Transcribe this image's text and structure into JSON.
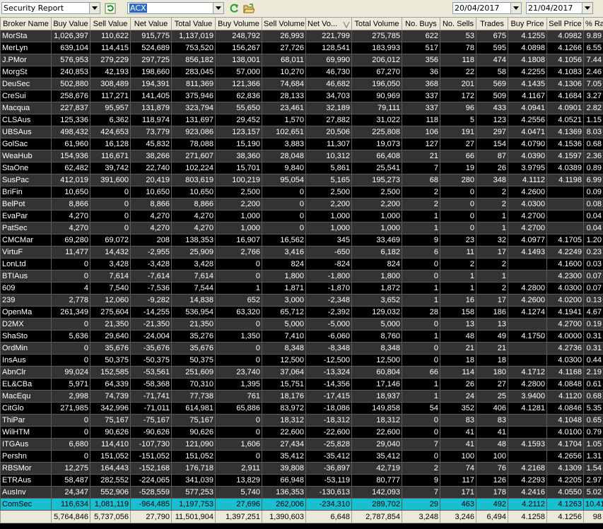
{
  "toolbar": {
    "report_select": "Security Report",
    "security_code": "ACX",
    "date_from": "20/04/2017",
    "date_to": "21/04/2017"
  },
  "table": {
    "columns": [
      "Broker Name",
      "Buy Value",
      "Sell Value",
      "Net Value",
      "Total Value",
      "Buy Volume",
      "Sell Volume",
      "Net Vo...",
      "Total Volume",
      "No. Buys",
      "No. Sells",
      "Trades",
      "Buy Price",
      "Sell Price",
      "% Rank"
    ],
    "rows": [
      [
        "MorSta",
        "1,026,397",
        "110,622",
        "915,775",
        "1,137,019",
        "248,792",
        "26,993",
        "221,799",
        "275,785",
        "622",
        "53",
        "675",
        "4.1255",
        "4.0982",
        "9.89"
      ],
      [
        "MerLyn",
        "639,104",
        "114,415",
        "524,689",
        "753,520",
        "156,267",
        "27,726",
        "128,541",
        "183,993",
        "517",
        "78",
        "595",
        "4.0898",
        "4.1266",
        "6.55"
      ],
      [
        "J.PMor",
        "576,953",
        "279,229",
        "297,725",
        "856,182",
        "138,001",
        "68,011",
        "69,990",
        "206,012",
        "356",
        "118",
        "474",
        "4.1808",
        "4.1056",
        "7.44"
      ],
      [
        "MorgSt",
        "240,853",
        "42,193",
        "198,660",
        "283,045",
        "57,000",
        "10,270",
        "46,730",
        "67,270",
        "36",
        "22",
        "58",
        "4.2255",
        "4.1083",
        "2.46"
      ],
      [
        "DeuSec",
        "502,880",
        "308,489",
        "194,391",
        "811,369",
        "121,366",
        "74,684",
        "46,682",
        "196,050",
        "368",
        "201",
        "569",
        "4.1435",
        "4.1306",
        "7.05"
      ],
      [
        "CreSui",
        "258,676",
        "117,271",
        "141,405",
        "375,946",
        "62,836",
        "28,133",
        "34,703",
        "90,969",
        "337",
        "172",
        "509",
        "4.1167",
        "4.1684",
        "3.27"
      ],
      [
        "Macqua",
        "227,837",
        "95,957",
        "131,879",
        "323,794",
        "55,650",
        "23,461",
        "32,189",
        "79,111",
        "337",
        "96",
        "433",
        "4.0941",
        "4.0901",
        "2.82"
      ],
      [
        "CLSAus",
        "125,336",
        "6,362",
        "118,974",
        "131,697",
        "29,452",
        "1,570",
        "27,882",
        "31,022",
        "118",
        "5",
        "123",
        "4.2556",
        "4.0521",
        "1.15"
      ],
      [
        "UBSAus",
        "498,432",
        "424,653",
        "73,779",
        "923,086",
        "123,157",
        "102,651",
        "20,506",
        "225,808",
        "106",
        "191",
        "297",
        "4.0471",
        "4.1369",
        "8.03"
      ],
      [
        "GolSac",
        "61,960",
        "16,128",
        "45,832",
        "78,088",
        "15,190",
        "3,883",
        "11,307",
        "19,073",
        "127",
        "27",
        "154",
        "4.0790",
        "4.1536",
        "0.68"
      ],
      [
        "WeaHub",
        "154,936",
        "116,671",
        "38,266",
        "271,607",
        "38,360",
        "28,048",
        "10,312",
        "66,408",
        "21",
        "66",
        "87",
        "4.0390",
        "4.1597",
        "2.36"
      ],
      [
        "StaOne",
        "62,482",
        "39,742",
        "22,740",
        "102,224",
        "15,701",
        "9,840",
        "5,861",
        "25,541",
        "7",
        "19",
        "26",
        "3.9795",
        "4.0389",
        "0.89"
      ],
      [
        "SusPac",
        "412,019",
        "391,600",
        "20,419",
        "803,619",
        "100,219",
        "95,054",
        "5,165",
        "195,273",
        "68",
        "280",
        "348",
        "4.1112",
        "4.1198",
        "6.99"
      ],
      [
        "BriFin",
        "10,650",
        "0",
        "10,650",
        "10,650",
        "2,500",
        "0",
        "2,500",
        "2,500",
        "2",
        "0",
        "2",
        "4.2600",
        "",
        "0.09"
      ],
      [
        "BelPot",
        "8,866",
        "0",
        "8,866",
        "8,866",
        "2,200",
        "0",
        "2,200",
        "2,200",
        "2",
        "0",
        "2",
        "4.0300",
        "",
        "0.08"
      ],
      [
        "EvaPar",
        "4,270",
        "0",
        "4,270",
        "4,270",
        "1,000",
        "0",
        "1,000",
        "1,000",
        "1",
        "0",
        "1",
        "4.2700",
        "",
        "0.04"
      ],
      [
        "PatSec",
        "4,270",
        "0",
        "4,270",
        "4,270",
        "1,000",
        "0",
        "1,000",
        "1,000",
        "1",
        "0",
        "1",
        "4.2700",
        "",
        "0.04"
      ],
      [
        "CMCMar",
        "69,280",
        "69,072",
        "208",
        "138,353",
        "16,907",
        "16,562",
        "345",
        "33,469",
        "9",
        "23",
        "32",
        "4.0977",
        "4.1705",
        "1.20"
      ],
      [
        "VirtuF",
        "11,477",
        "14,432",
        "-2,955",
        "25,909",
        "2,766",
        "3,416",
        "-650",
        "6,182",
        "6",
        "11",
        "17",
        "4.1493",
        "4.2249",
        "0.23"
      ],
      [
        "LonLtd",
        "0",
        "3,428",
        "-3,428",
        "3,428",
        "0",
        "824",
        "-824",
        "824",
        "0",
        "2",
        "2",
        "",
        "4.1600",
        "0.03"
      ],
      [
        "BTIAus",
        "0",
        "7,614",
        "-7,614",
        "7,614",
        "0",
        "1,800",
        "-1,800",
        "1,800",
        "0",
        "1",
        "1",
        "",
        "4.2300",
        "0.07"
      ],
      [
        "609",
        "4",
        "7,540",
        "-7,536",
        "7,544",
        "1",
        "1,871",
        "-1,870",
        "1,872",
        "1",
        "1",
        "2",
        "4.2800",
        "4.0300",
        "0.07"
      ],
      [
        "239",
        "2,778",
        "12,060",
        "-9,282",
        "14,838",
        "652",
        "3,000",
        "-2,348",
        "3,652",
        "1",
        "16",
        "17",
        "4.2600",
        "4.0200",
        "0.13"
      ],
      [
        "OpenMa",
        "261,349",
        "275,604",
        "-14,255",
        "536,954",
        "63,320",
        "65,712",
        "-2,392",
        "129,032",
        "28",
        "158",
        "186",
        "4.1274",
        "4.1941",
        "4.67"
      ],
      [
        "D2MX",
        "0",
        "21,350",
        "-21,350",
        "21,350",
        "0",
        "5,000",
        "-5,000",
        "5,000",
        "0",
        "13",
        "13",
        "",
        "4.2700",
        "0.19"
      ],
      [
        "ShaSto",
        "5,636",
        "29,640",
        "-24,004",
        "35,276",
        "1,350",
        "7,410",
        "-6,060",
        "8,760",
        "1",
        "48",
        "49",
        "4.1750",
        "4.0000",
        "0.31"
      ],
      [
        "OrdMin",
        "0",
        "35,676",
        "-35,676",
        "35,676",
        "0",
        "8,348",
        "-8,348",
        "8,348",
        "0",
        "21",
        "21",
        "",
        "4.2736",
        "0.31"
      ],
      [
        "InsAus",
        "0",
        "50,375",
        "-50,375",
        "50,375",
        "0",
        "12,500",
        "-12,500",
        "12,500",
        "0",
        "18",
        "18",
        "",
        "4.0300",
        "0.44"
      ],
      [
        "AbnClr",
        "99,024",
        "152,585",
        "-53,561",
        "251,609",
        "23,740",
        "37,064",
        "-13,324",
        "60,804",
        "66",
        "114",
        "180",
        "4.1712",
        "4.1168",
        "2.19"
      ],
      [
        "EL&CBa",
        "5,971",
        "64,339",
        "-58,368",
        "70,310",
        "1,395",
        "15,751",
        "-14,356",
        "17,146",
        "1",
        "26",
        "27",
        "4.2800",
        "4.0848",
        "0.61"
      ],
      [
        "MacEqu",
        "2,998",
        "74,739",
        "-71,741",
        "77,738",
        "761",
        "18,176",
        "-17,415",
        "18,937",
        "1",
        "24",
        "25",
        "3.9400",
        "4.1120",
        "0.68"
      ],
      [
        "CitGlo",
        "271,985",
        "342,996",
        "-71,011",
        "614,981",
        "65,886",
        "83,972",
        "-18,086",
        "149,858",
        "54",
        "352",
        "406",
        "4.1281",
        "4.0846",
        "5.35"
      ],
      [
        "ThiPar",
        "0",
        "75,167",
        "-75,167",
        "75,167",
        "0",
        "18,312",
        "-18,312",
        "18,312",
        "0",
        "83",
        "83",
        "",
        "4.1048",
        "0.65"
      ],
      [
        "WilHTM",
        "0",
        "90,626",
        "-90,626",
        "90,626",
        "0",
        "22,600",
        "-22,600",
        "22,600",
        "0",
        "41",
        "41",
        "",
        "4.0100",
        "0.79"
      ],
      [
        "ITGAus",
        "6,680",
        "114,410",
        "-107,730",
        "121,090",
        "1,606",
        "27,434",
        "-25,828",
        "29,040",
        "7",
        "41",
        "48",
        "4.1593",
        "4.1704",
        "1.05"
      ],
      [
        "Pershn",
        "0",
        "151,052",
        "-151,052",
        "151,052",
        "0",
        "35,412",
        "-35,412",
        "35,412",
        "0",
        "100",
        "100",
        "",
        "4.2656",
        "1.31"
      ],
      [
        "RBSMor",
        "12,275",
        "164,443",
        "-152,168",
        "176,718",
        "2,911",
        "39,808",
        "-36,897",
        "42,719",
        "2",
        "74",
        "76",
        "4.2168",
        "4.1309",
        "1.54"
      ],
      [
        "ETRAus",
        "58,487",
        "282,552",
        "-224,065",
        "341,039",
        "13,829",
        "66,948",
        "-53,119",
        "80,777",
        "9",
        "117",
        "126",
        "4.2293",
        "4.2205",
        "2.97"
      ],
      [
        "AusInv",
        "24,347",
        "552,906",
        "-528,559",
        "577,253",
        "5,740",
        "136,353",
        "-130,613",
        "142,093",
        "7",
        "171",
        "178",
        "4.2416",
        "4.0550",
        "5.02"
      ],
      [
        "ComSec",
        "116,634",
        "1,081,119",
        "-964,485",
        "1,197,753",
        "27,696",
        "262,006",
        "-234,310",
        "289,702",
        "29",
        "463",
        "492",
        "4.2112",
        "4.1263",
        "10.41"
      ]
    ],
    "selected_row": "ComSec",
    "totals": [
      "",
      "5,764,846",
      "5,737,056",
      "27,790",
      "11,501,904",
      "1,397,251",
      "1,390,603",
      "6,648",
      "2,787,854",
      "3,248",
      "3,246",
      "6,494",
      "4.1258",
      "4.1256",
      "98"
    ]
  }
}
